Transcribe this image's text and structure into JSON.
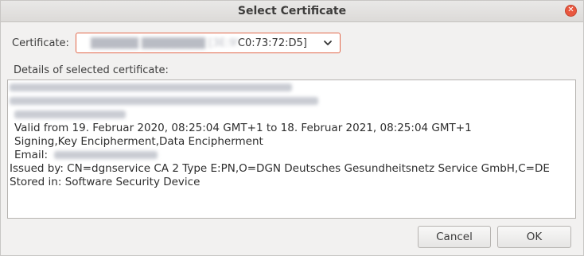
{
  "window": {
    "title": "Select Certificate"
  },
  "certificate": {
    "label": "Certificate:",
    "selected_value": "C0:73:72:D5]"
  },
  "details": {
    "label": "Details of selected certificate:",
    "valid_line": "Valid from 19. Februar 2020, 08:25:04 GMT+1 to 18. Februar 2021, 08:25:04 GMT+1",
    "usage_line": "Signing,Key Encipherment,Data Encipherment",
    "email_label": "Email:",
    "issued_line": "Issued by: CN=dgnservice CA 2 Type E:PN,O=DGN Deutsches Gesundheitsnetz Service GmbH,C=DE",
    "stored_line": "Stored in: Software Security Device"
  },
  "buttons": {
    "cancel": "Cancel",
    "ok": "OK"
  },
  "icons": {
    "close": "close-icon",
    "dropdown": "chevron-down-icon"
  },
  "colors": {
    "close_button": "#e9573f",
    "select_focus_border": "#e2674a"
  }
}
